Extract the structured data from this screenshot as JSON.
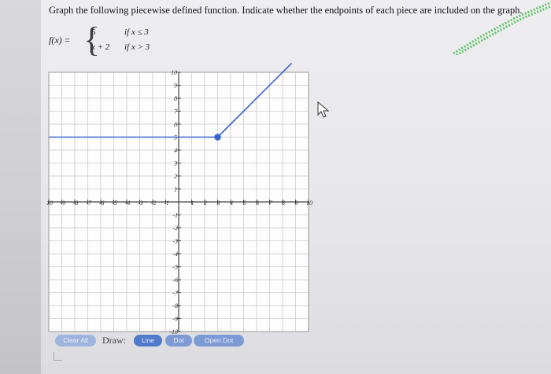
{
  "instruction": "Graph the following piecewise defined function. Indicate whether the endpoints of each piece are included on the graph.",
  "function_def": {
    "name": "f(x) =",
    "pieces": [
      {
        "expression": "5",
        "condition": "if  x ≤ 3"
      },
      {
        "expression": "x + 2",
        "condition": "if  x > 3"
      }
    ]
  },
  "graph": {
    "x_range": [
      -10,
      10
    ],
    "y_range": [
      -10,
      10
    ],
    "x_tick_labels": [
      "10",
      "-9",
      "-8",
      "-7",
      "-6",
      "-5",
      "-4",
      "-3",
      "-2",
      "-1",
      "1",
      "2",
      "3",
      "4",
      "5",
      "6",
      "7",
      "8",
      "9",
      "10"
    ],
    "y_tick_labels_pos": [
      "1",
      "2",
      "3",
      "4",
      "5",
      "6",
      "7",
      "8",
      "9",
      "10"
    ],
    "y_tick_labels_neg": [
      "-1",
      "-2",
      "-3",
      "-4",
      "-5",
      "-6",
      "-7",
      "-8",
      "-9",
      "-10"
    ],
    "line_color": "#3a63d0",
    "segments": [
      {
        "from": [
          -10,
          5
        ],
        "to": [
          3,
          5
        ]
      },
      {
        "from": [
          3,
          5
        ],
        "to": [
          8.7,
          10.7
        ]
      }
    ],
    "points": [
      {
        "x": 3,
        "y": 5,
        "type": "closed"
      }
    ]
  },
  "toolbar": {
    "clear_all": "Clear All",
    "draw_label": "Draw:",
    "line": "Line",
    "dot": "Dot",
    "open_dot": "Open Dot"
  }
}
